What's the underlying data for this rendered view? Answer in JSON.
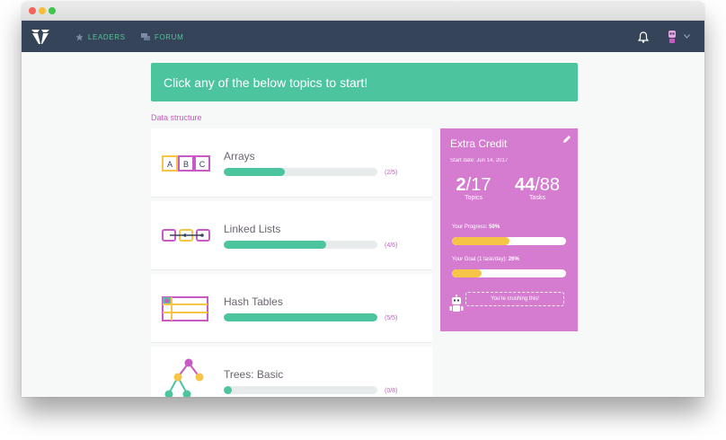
{
  "nav": {
    "leaders_label": "LEADERS",
    "forum_label": "FORUM"
  },
  "banner": {
    "text": "Click any of the below topics to start!"
  },
  "section": {
    "label": "Data structure"
  },
  "topics": [
    {
      "name": "Arrays",
      "progress": 0.4,
      "count": "(2/5)",
      "icon": "abc-boxes-icon"
    },
    {
      "name": "Linked Lists",
      "progress": 0.667,
      "count": "(4/6)",
      "icon": "linked-nodes-icon"
    },
    {
      "name": "Hash Tables",
      "progress": 1.0,
      "count": "(5/5)",
      "icon": "hash-table-icon"
    },
    {
      "name": "Trees: Basic",
      "progress": 0.0,
      "count": "(0/8)",
      "icon": "tree-icon"
    }
  ],
  "credit": {
    "title": "Extra Credit",
    "start_date": "Start date: Jun 14, 2017",
    "topics_num": "2",
    "topics_den": "/17",
    "topics_label": "Topics",
    "tasks_num": "44",
    "tasks_den": "/88",
    "tasks_label": "Tasks",
    "progress_label": "Your Progress:",
    "progress_value": "50%",
    "progress_fraction": 0.5,
    "goal_label": "Your Goal (1 task/day):",
    "goal_value": "26%",
    "goal_fraction": 0.26,
    "message": "You're crushing this!"
  },
  "colors": {
    "nav_bg": "#354458",
    "accent_green": "#4cc49e",
    "accent_pink": "#d57cd0",
    "progress_yellow": "#f6c548"
  }
}
